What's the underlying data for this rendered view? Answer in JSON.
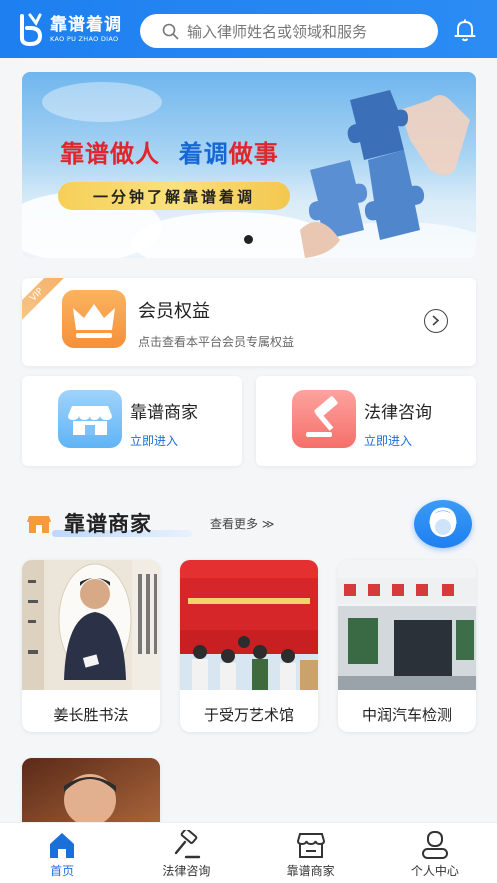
{
  "header": {
    "logo_cn": "靠谱着调",
    "logo_en": "KAO PU ZHAO DIAO",
    "search_placeholder": "输入律师姓名或领域和服务",
    "icons": {
      "search": "search-icon",
      "bell": "bell-icon"
    }
  },
  "banner": {
    "title_part1": "靠谱",
    "title_part2": "做人",
    "title_part3": "着调",
    "title_part4": "做事",
    "subtitle": "一分钟了解靠谱着调",
    "page_indicator": {
      "current": 1,
      "total": 1
    }
  },
  "member": {
    "badge": "VIP",
    "title": "会员权益",
    "desc": "点击查看本平台会员专属权益"
  },
  "quick": [
    {
      "title": "靠谱商家",
      "link": "立即进入"
    },
    {
      "title": "法律咨询",
      "link": "立即进入"
    }
  ],
  "section": {
    "title": "靠谱商家",
    "more": "查看更多 ≫"
  },
  "merchants": [
    {
      "name": "姜长胜书法"
    },
    {
      "name": "于受万艺术馆"
    },
    {
      "name": "中润汽车检测"
    },
    {
      "name": ""
    }
  ],
  "tabs": [
    {
      "label": "首页",
      "icon": "home-icon",
      "active": true
    },
    {
      "label": "法律咨询",
      "icon": "gavel-icon",
      "active": false
    },
    {
      "label": "靠谱商家",
      "icon": "store-icon",
      "active": false
    },
    {
      "label": "个人中心",
      "icon": "user-icon",
      "active": false
    }
  ],
  "colors": {
    "brand_blue": "#1e7ff0",
    "link_blue": "#1b6fd9",
    "banner_red": "#e0262c"
  }
}
